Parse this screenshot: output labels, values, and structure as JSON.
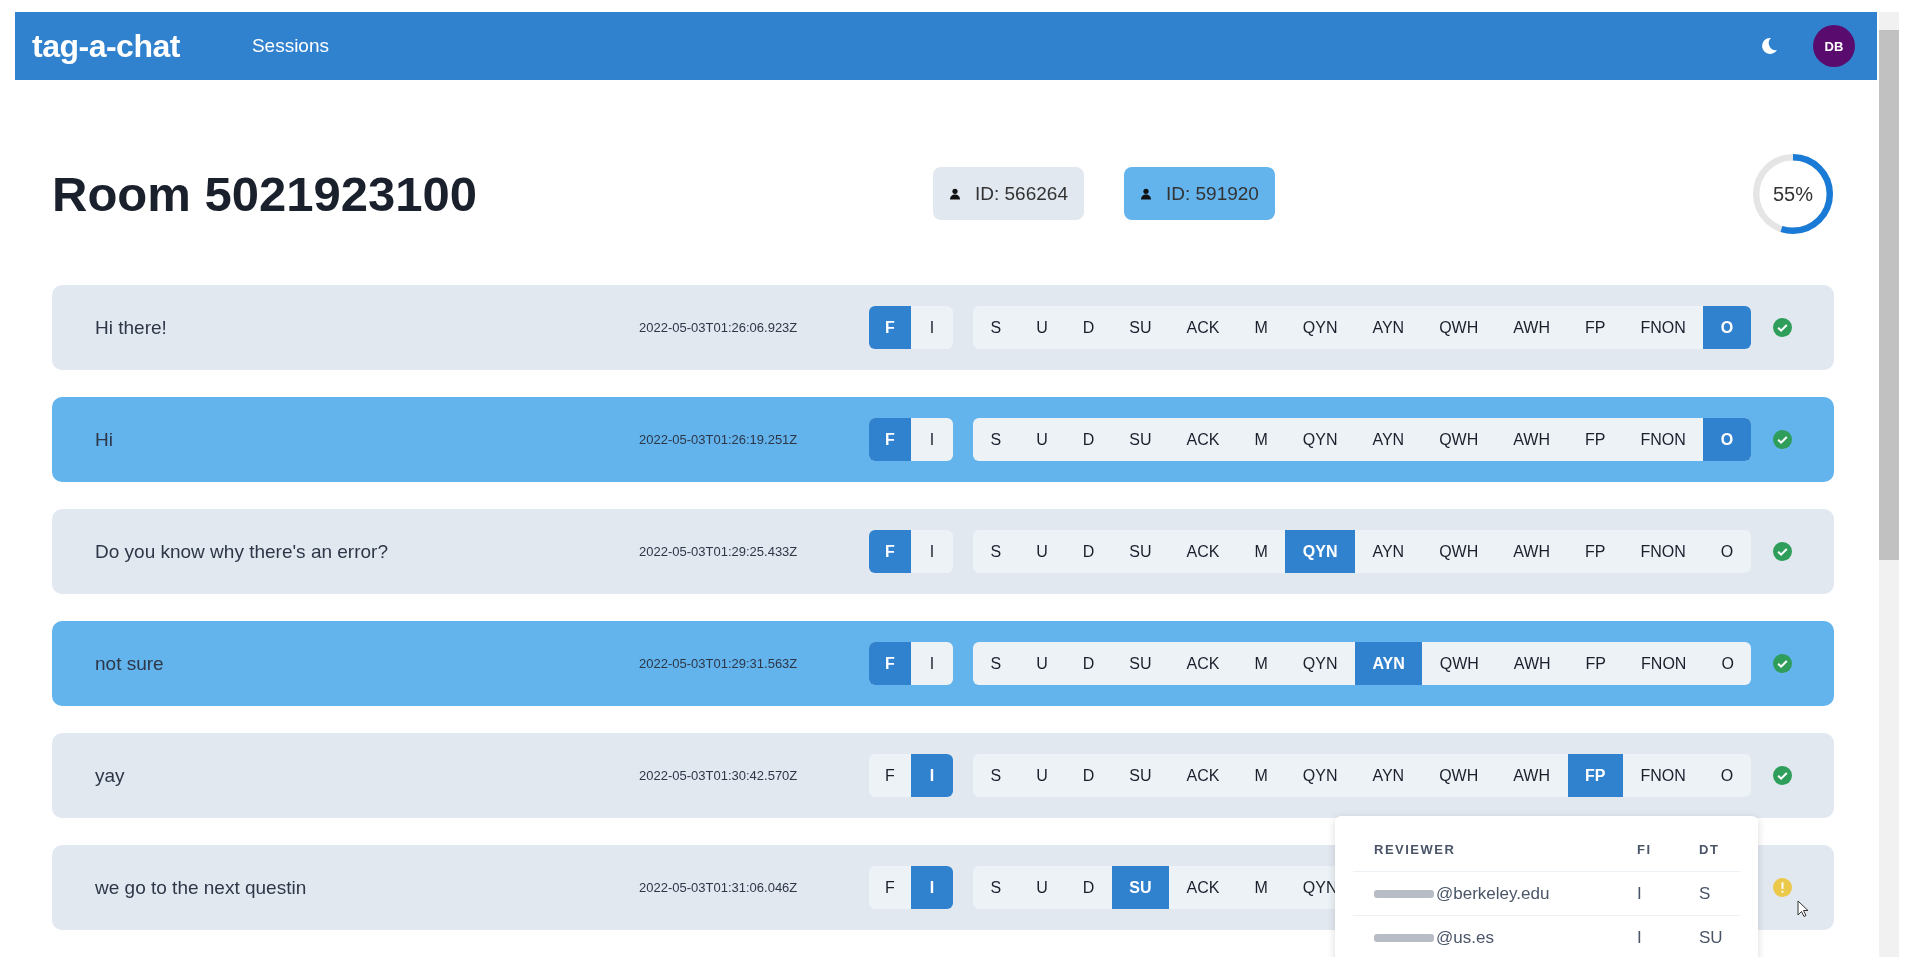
{
  "navbar": {
    "brand": "tag-a-chat",
    "links": [
      {
        "label": "Sessions"
      }
    ],
    "avatar": "DB"
  },
  "room": {
    "title": "Room 5021923100",
    "participants": [
      {
        "label": "ID: 566264",
        "selected": false
      },
      {
        "label": "ID: 591920",
        "selected": true
      }
    ],
    "progress": {
      "level": 0.55,
      "label": "55%"
    }
  },
  "messages": [
    {
      "text": "Hi there!",
      "time": "2022-05-03T01:26:06.923Z",
      "highlighted": false,
      "kind": "ok",
      "fi": [
        {
          "label": "F",
          "selected": true
        },
        {
          "label": "I",
          "selected": false
        }
      ],
      "tags": [
        {
          "label": "S",
          "selected": false
        },
        {
          "label": "U",
          "selected": false
        },
        {
          "label": "D",
          "selected": false
        },
        {
          "label": "SU",
          "selected": false
        },
        {
          "label": "ACK",
          "selected": false
        },
        {
          "label": "M",
          "selected": false
        },
        {
          "label": "QYN",
          "selected": false
        },
        {
          "label": "AYN",
          "selected": false
        },
        {
          "label": "QWH",
          "selected": false
        },
        {
          "label": "AWH",
          "selected": false
        },
        {
          "label": "FP",
          "selected": false
        },
        {
          "label": "FNON",
          "selected": false
        },
        {
          "label": "O",
          "selected": true
        }
      ]
    },
    {
      "text": "Hi",
      "time": "2022-05-03T01:26:19.251Z",
      "highlighted": true,
      "kind": "ok",
      "fi": [
        {
          "label": "F",
          "selected": true
        },
        {
          "label": "I",
          "selected": false
        }
      ],
      "tags": [
        {
          "label": "S",
          "selected": false
        },
        {
          "label": "U",
          "selected": false
        },
        {
          "label": "D",
          "selected": false
        },
        {
          "label": "SU",
          "selected": false
        },
        {
          "label": "ACK",
          "selected": false
        },
        {
          "label": "M",
          "selected": false
        },
        {
          "label": "QYN",
          "selected": false
        },
        {
          "label": "AYN",
          "selected": false
        },
        {
          "label": "QWH",
          "selected": false
        },
        {
          "label": "AWH",
          "selected": false
        },
        {
          "label": "FP",
          "selected": false
        },
        {
          "label": "FNON",
          "selected": false
        },
        {
          "label": "O",
          "selected": true
        }
      ]
    },
    {
      "text": "Do you know why there's an error?",
      "time": "2022-05-03T01:29:25.433Z",
      "highlighted": false,
      "kind": "ok",
      "fi": [
        {
          "label": "F",
          "selected": true
        },
        {
          "label": "I",
          "selected": false
        }
      ],
      "tags": [
        {
          "label": "S",
          "selected": false
        },
        {
          "label": "U",
          "selected": false
        },
        {
          "label": "D",
          "selected": false
        },
        {
          "label": "SU",
          "selected": false
        },
        {
          "label": "ACK",
          "selected": false
        },
        {
          "label": "M",
          "selected": false
        },
        {
          "label": "QYN",
          "selected": true
        },
        {
          "label": "AYN",
          "selected": false
        },
        {
          "label": "QWH",
          "selected": false
        },
        {
          "label": "AWH",
          "selected": false
        },
        {
          "label": "FP",
          "selected": false
        },
        {
          "label": "FNON",
          "selected": false
        },
        {
          "label": "O",
          "selected": false
        }
      ]
    },
    {
      "text": "not sure",
      "time": "2022-05-03T01:29:31.563Z",
      "highlighted": true,
      "kind": "ok",
      "fi": [
        {
          "label": "F",
          "selected": true
        },
        {
          "label": "I",
          "selected": false
        }
      ],
      "tags": [
        {
          "label": "S",
          "selected": false
        },
        {
          "label": "U",
          "selected": false
        },
        {
          "label": "D",
          "selected": false
        },
        {
          "label": "SU",
          "selected": false
        },
        {
          "label": "ACK",
          "selected": false
        },
        {
          "label": "M",
          "selected": false
        },
        {
          "label": "QYN",
          "selected": false
        },
        {
          "label": "AYN",
          "selected": true
        },
        {
          "label": "QWH",
          "selected": false
        },
        {
          "label": "AWH",
          "selected": false
        },
        {
          "label": "FP",
          "selected": false
        },
        {
          "label": "FNON",
          "selected": false
        },
        {
          "label": "O",
          "selected": false
        }
      ]
    },
    {
      "text": "yay",
      "time": "2022-05-03T01:30:42.570Z",
      "highlighted": false,
      "kind": "ok",
      "fi": [
        {
          "label": "F",
          "selected": false
        },
        {
          "label": "I",
          "selected": true
        }
      ],
      "tags": [
        {
          "label": "S",
          "selected": false
        },
        {
          "label": "U",
          "selected": false
        },
        {
          "label": "D",
          "selected": false
        },
        {
          "label": "SU",
          "selected": false
        },
        {
          "label": "ACK",
          "selected": false
        },
        {
          "label": "M",
          "selected": false
        },
        {
          "label": "QYN",
          "selected": false
        },
        {
          "label": "AYN",
          "selected": false
        },
        {
          "label": "QWH",
          "selected": false
        },
        {
          "label": "AWH",
          "selected": false
        },
        {
          "label": "FP",
          "selected": true
        },
        {
          "label": "FNON",
          "selected": false
        },
        {
          "label": "O",
          "selected": false
        }
      ]
    },
    {
      "text": "we go to the next questin",
      "time": "2022-05-03T01:31:06.046Z",
      "highlighted": false,
      "kind": "warning",
      "fi": [
        {
          "label": "F",
          "selected": false
        },
        {
          "label": "I",
          "selected": true
        }
      ],
      "tags": [
        {
          "label": "S",
          "selected": false
        },
        {
          "label": "U",
          "selected": false
        },
        {
          "label": "D",
          "selected": false
        },
        {
          "label": "SU",
          "selected": true
        },
        {
          "label": "ACK",
          "selected": false
        },
        {
          "label": "M",
          "selected": false
        },
        {
          "label": "QYN",
          "selected": false
        }
      ]
    }
  ],
  "review_popup": {
    "columns": [
      "REVIEWER",
      "FI",
      "DT"
    ],
    "rows": [
      [
        "@berkeley.edu",
        "I",
        "S"
      ],
      [
        "@us.es",
        "I",
        "SU"
      ]
    ]
  }
}
